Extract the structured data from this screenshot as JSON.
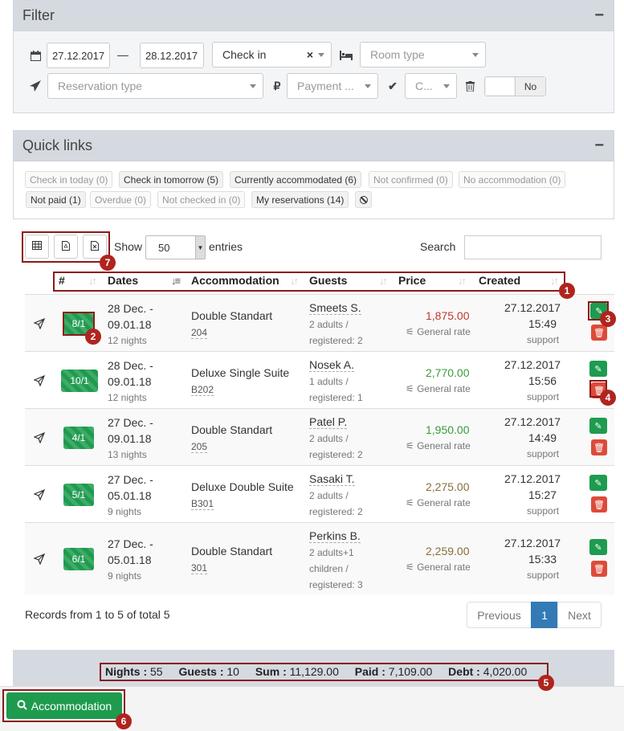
{
  "filter": {
    "title": "Filter",
    "collapse": "−",
    "date_from": "27.12.2017",
    "dash": "—",
    "date_to": "28.12.2017",
    "check_select": "Check in",
    "clear": "×",
    "room_type_placeholder": "Room type",
    "reservation_type_placeholder": "Reservation type",
    "payment_placeholder": "Payment ...",
    "confirm_placeholder": "C...",
    "toggle_no": "No"
  },
  "quick_links": {
    "title": "Quick links",
    "collapse": "−",
    "items": [
      {
        "label": "Check in today (0)",
        "active": false
      },
      {
        "label": "Check in tomorrow (5)",
        "active": true
      },
      {
        "label": "Currently accommodated (6)",
        "active": true
      },
      {
        "label": "Not confirmed (0)",
        "active": false
      },
      {
        "label": "No accommodation (0)",
        "active": false
      },
      {
        "label": "Not paid (1)",
        "active": true
      },
      {
        "label": "Overdue (0)",
        "active": false
      },
      {
        "label": "Not checked in (0)",
        "active": false
      },
      {
        "label": "My reservations (14)",
        "active": true
      }
    ]
  },
  "table_controls": {
    "show": "Show",
    "entries_value": "50",
    "entries": "entries",
    "search": "Search"
  },
  "columns": [
    "#",
    "Dates",
    "Accommodation",
    "Guests",
    "Price",
    "Created"
  ],
  "rows": [
    {
      "badge": "8/1",
      "date1": "28 Dec. -",
      "date2": "09.01.18",
      "nights": "12 nights",
      "room": "Double Standart",
      "room_id": "204",
      "guest": "Smeets S.",
      "g1": "2 adults /",
      "g2": "registered: 2",
      "price": "1,875.00",
      "price_color": "#c0392b",
      "rate": "General rate",
      "c_date": "27.12.2017",
      "c_time": "15:49",
      "c_by": "support"
    },
    {
      "badge": "10/1",
      "date1": "28 Dec. -",
      "date2": "09.01.18",
      "nights": "12 nights",
      "room": "Deluxe Single Suite",
      "room_id": "B202",
      "guest": "Nosek A.",
      "g1": "1 adults /",
      "g2": "registered: 1",
      "price": "2,770.00",
      "price_color": "#3c9a3c",
      "rate": "General rate",
      "c_date": "27.12.2017",
      "c_time": "15:56",
      "c_by": "support"
    },
    {
      "badge": "4/1",
      "date1": "27 Dec. -",
      "date2": "09.01.18",
      "nights": "13 nights",
      "room": "Double Standart",
      "room_id": "205",
      "guest": "Patel P.",
      "g1": "2 adults /",
      "g2": "registered: 2",
      "price": "1,950.00",
      "price_color": "#3c9a3c",
      "rate": "General rate",
      "c_date": "27.12.2017",
      "c_time": "14:49",
      "c_by": "support"
    },
    {
      "badge": "5/1",
      "date1": "27 Dec. -",
      "date2": "05.01.18",
      "nights": "9 nights",
      "room": "Deluxe Double Suite",
      "room_id": "B301",
      "guest": "Sasaki T.",
      "g1": "2 adults /",
      "g2": "registered: 2",
      "price": "2,275.00",
      "price_color": "#8a6d3b",
      "rate": "General rate",
      "c_date": "27.12.2017",
      "c_time": "15:27",
      "c_by": "support"
    },
    {
      "badge": "6/1",
      "date1": "27 Dec. -",
      "date2": "05.01.18",
      "nights": "9 nights",
      "room": "Double Standart",
      "room_id": "301",
      "guest": "Perkins B.",
      "g1": "2 adults+1",
      "g2": "children /",
      "g3": "registered: 3",
      "price": "2,259.00",
      "price_color": "#8a6d3b",
      "rate": "General rate",
      "c_date": "27.12.2017",
      "c_time": "15:33",
      "c_by": "support"
    }
  ],
  "records": "Records from 1 to 5 of total 5",
  "pagination": {
    "prev": "Previous",
    "page": "1",
    "next": "Next"
  },
  "summary": {
    "nights_label": "Nights :",
    "nights": "55",
    "guests_label": "Guests :",
    "guests": "10",
    "sum_label": "Sum :",
    "sum": "11,129.00",
    "paid_label": "Paid :",
    "paid": "7,109.00",
    "debt_label": "Debt :",
    "debt": "4,020.00"
  },
  "accommodation_button": "Accommodation",
  "markers": [
    "1",
    "2",
    "3",
    "4",
    "5",
    "6",
    "7"
  ]
}
